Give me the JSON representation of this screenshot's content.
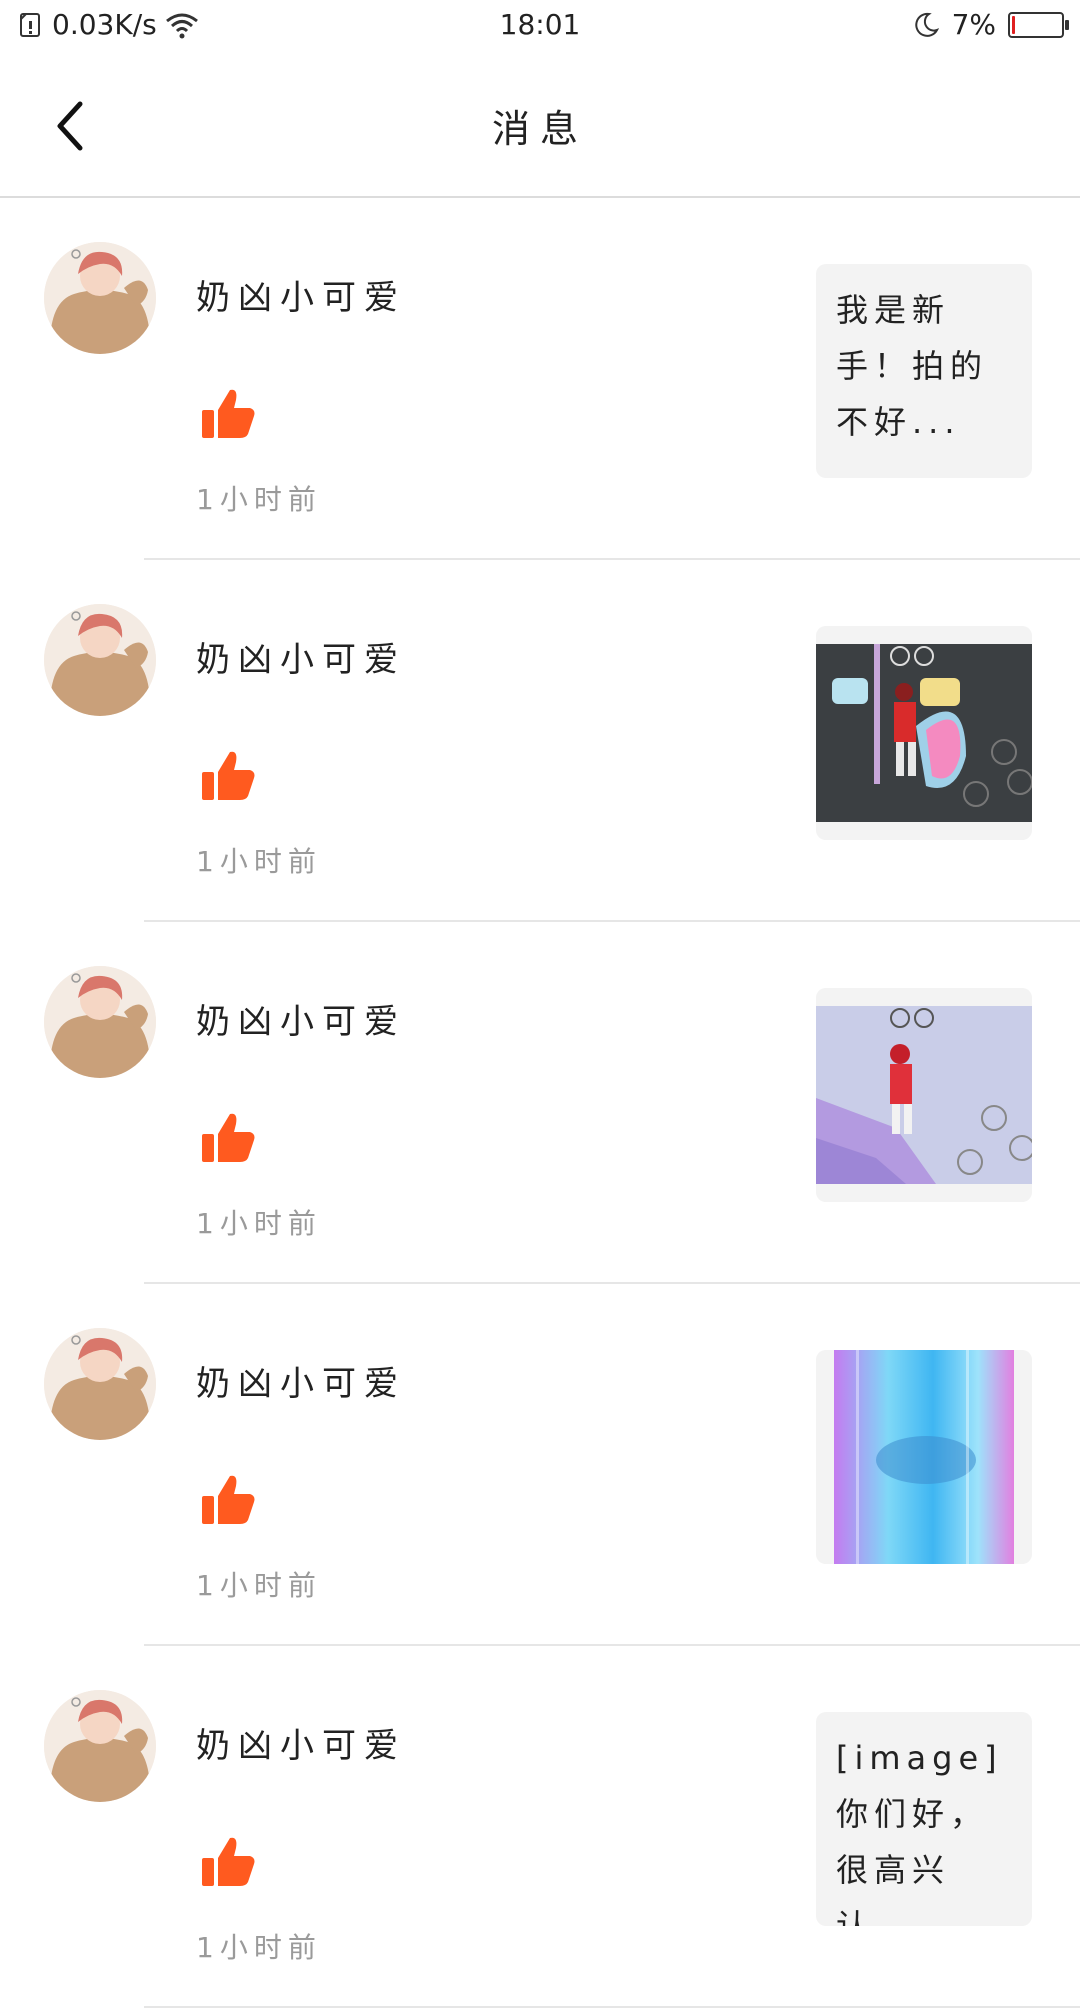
{
  "status_bar": {
    "network_speed": "0.03K/s",
    "time": "18:01",
    "battery_percent": "7%",
    "battery_level": 0.07,
    "icons": [
      "sim-icon",
      "wifi-icon",
      "moon-icon",
      "battery-icon"
    ]
  },
  "nav": {
    "title": "消息",
    "back_icon": "chevron-left-icon"
  },
  "messages": [
    {
      "user": "奶凶小可爱",
      "time": "1小时前",
      "action_icon": "thumbs-up-icon",
      "preview_type": "text",
      "preview_text": "我是新手！拍的不好..."
    },
    {
      "user": "奶凶小可爱",
      "time": "1小时前",
      "action_icon": "thumbs-up-icon",
      "preview_type": "image"
    },
    {
      "user": "奶凶小可爱",
      "time": "1小时前",
      "action_icon": "thumbs-up-icon",
      "preview_type": "image"
    },
    {
      "user": "奶凶小可爱",
      "time": "1小时前",
      "action_icon": "thumbs-up-icon",
      "preview_type": "image"
    },
    {
      "user": "奶凶小可爱",
      "time": "1小时前",
      "action_icon": "thumbs-up-icon",
      "preview_type": "text",
      "preview_text": "[image]你们好，很高兴认..."
    }
  ],
  "colors": {
    "like": "#ff5a1f",
    "time_text": "#9a9a9a",
    "divider": "#e6e6e6",
    "battery_low": "#e02020"
  }
}
